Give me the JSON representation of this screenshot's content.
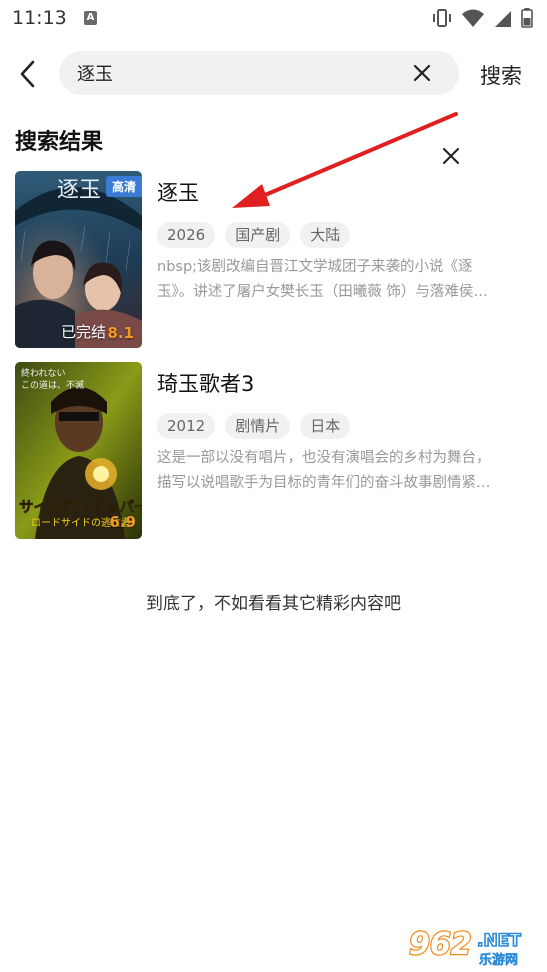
{
  "status_bar": {
    "time": "11:13",
    "notif_letter": "A",
    "icons": [
      "vibrate-icon",
      "wifi-icon",
      "signal-icon",
      "battery-icon"
    ]
  },
  "search": {
    "query": "逐玉",
    "button_label": "搜索"
  },
  "section_title": "搜索结果",
  "results": [
    {
      "title": "逐玉",
      "tags": [
        "2026",
        "国产剧",
        "大陆"
      ],
      "desc_lines": [
        "nbsp;该剧改编自晋江文学城团子来袭的小说《逐",
        "玉》。讲述了屠户女樊长玉（田曦薇 饰）与落难侯…"
      ],
      "badge": "高清",
      "poster_status": "已完结",
      "score": "8.1",
      "poster_title": "逐玉"
    },
    {
      "title": "琦玉歌者3",
      "tags": [
        "2012",
        "剧情片",
        "日本"
      ],
      "desc_lines": [
        "这是一部以没有唱片，也没有演唱会的乡村为舞台，",
        "描写以说唱歌手为目标的青年们的奋斗故事剧情紧…"
      ],
      "score": "6.9",
      "poster_title": "サイタマノラッパー",
      "poster_subtitle": "ロードサイドの逃亡者",
      "poster_tagline_1": "終われない",
      "poster_tagline_2": "この道は、不滅"
    }
  ],
  "footer_text": "到底了，不如看看其它精彩内容吧",
  "watermark": {
    "number": "962",
    "net": ".NET",
    "sub": "乐游网"
  },
  "colors": {
    "arrow": "#e02020",
    "score": "#f39a24",
    "badge": "#3a7bd5"
  }
}
